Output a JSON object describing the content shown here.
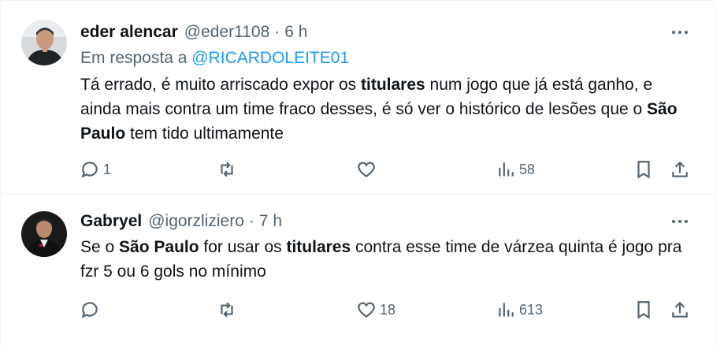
{
  "tweets": [
    {
      "name": "eder alencar",
      "handle": "@eder1108",
      "separator": "·",
      "time": "6 h",
      "reply_prefix": "Em resposta a",
      "reply_mention": "@RICARDOLEITE01",
      "text_parts": [
        "Tá errado, é muito arriscado expor os ",
        "titulares",
        " num jogo que já está ganho, e ainda mais contra um time fraco desses, é só ver o histórico de lesões que o ",
        "São Paulo",
        " tem tido ultimamente"
      ],
      "replies": "1",
      "retweets": "",
      "likes": "",
      "views": "58",
      "icons": [
        "reply-icon",
        "retweet-icon",
        "like-icon",
        "views-icon",
        "bookmark-icon",
        "share-icon"
      ]
    },
    {
      "name": "Gabryel",
      "handle": "@igorzliziero",
      "separator": "·",
      "time": "7 h",
      "text_parts": [
        "Se o ",
        "São Paulo",
        " for usar os ",
        "titulares",
        " contra esse time de várzea quinta é jogo pra fzr 5 ou 6 gols no mínimo"
      ],
      "replies": "",
      "retweets": "",
      "likes": "18",
      "views": "613",
      "icons": [
        "reply-icon",
        "retweet-icon",
        "like-icon",
        "views-icon",
        "bookmark-icon",
        "share-icon"
      ]
    }
  ],
  "colors": {
    "text": "#0f1419",
    "secondary": "#536471",
    "link": "#1d9bf0",
    "border": "#eff3f4"
  }
}
